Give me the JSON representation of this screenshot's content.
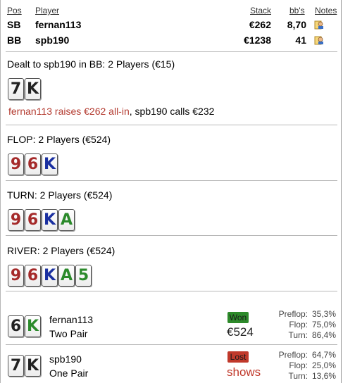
{
  "header": {
    "col_pos": "Pos",
    "col_player": "Player",
    "col_stack": "Stack",
    "col_bb": "bb's",
    "col_notes": "Notes"
  },
  "players": [
    {
      "pos": "SB",
      "name": "fernan113",
      "stack": "€262",
      "bbs": "8,70",
      "note_icon": "notes-icon"
    },
    {
      "pos": "BB",
      "name": "spb190",
      "stack": "€1238",
      "bbs": "41",
      "note_icon": "notes-icon"
    }
  ],
  "preflop": {
    "title": "Dealt to spb190 in BB: 2 Players (€15)",
    "cards": [
      {
        "rank": "7",
        "color": "#222222"
      },
      {
        "rank": "K",
        "color": "#222222"
      }
    ],
    "action_red": "fernan113 raises €262 all-in",
    "action_rest": ", spb190 calls €232"
  },
  "flop": {
    "title": "FLOP: 2 Players (€524)",
    "cards": [
      {
        "rank": "9",
        "color": "#a52a2a"
      },
      {
        "rank": "6",
        "color": "#a52a2a"
      },
      {
        "rank": "K",
        "color": "#1a2fa0"
      }
    ]
  },
  "turn": {
    "title": "TURN: 2 Players (€524)",
    "cards": [
      {
        "rank": "9",
        "color": "#a52a2a"
      },
      {
        "rank": "6",
        "color": "#a52a2a"
      },
      {
        "rank": "K",
        "color": "#1a2fa0"
      },
      {
        "rank": "A",
        "color": "#2b8a2b"
      }
    ]
  },
  "river": {
    "title": "RIVER: 2 Players (€524)",
    "cards": [
      {
        "rank": "9",
        "color": "#a52a2a"
      },
      {
        "rank": "6",
        "color": "#a52a2a"
      },
      {
        "rank": "K",
        "color": "#1a2fa0"
      },
      {
        "rank": "A",
        "color": "#2b8a2b"
      },
      {
        "rank": "5",
        "color": "#2b8a2b"
      }
    ]
  },
  "results": [
    {
      "cards": [
        {
          "rank": "6",
          "color": "#222222"
        },
        {
          "rank": "K",
          "color": "#2b8a2b"
        }
      ],
      "name": "fernan113",
      "hand": "Two Pair",
      "badge": "Won",
      "amount": "€524",
      "stats": [
        {
          "label": "Preflop:",
          "value": "35,3%"
        },
        {
          "label": "Flop:",
          "value": "75,0%"
        },
        {
          "label": "Turn:",
          "value": "86,4%"
        }
      ]
    },
    {
      "cards": [
        {
          "rank": "7",
          "color": "#222222"
        },
        {
          "rank": "K",
          "color": "#222222"
        }
      ],
      "name": "spb190",
      "hand": "One Pair",
      "badge": "Lost",
      "amount": "shows",
      "stats": [
        {
          "label": "Preflop:",
          "value": "64,7%"
        },
        {
          "label": "Flop:",
          "value": "25,0%"
        },
        {
          "label": "Turn:",
          "value": "13,6%"
        }
      ]
    }
  ]
}
